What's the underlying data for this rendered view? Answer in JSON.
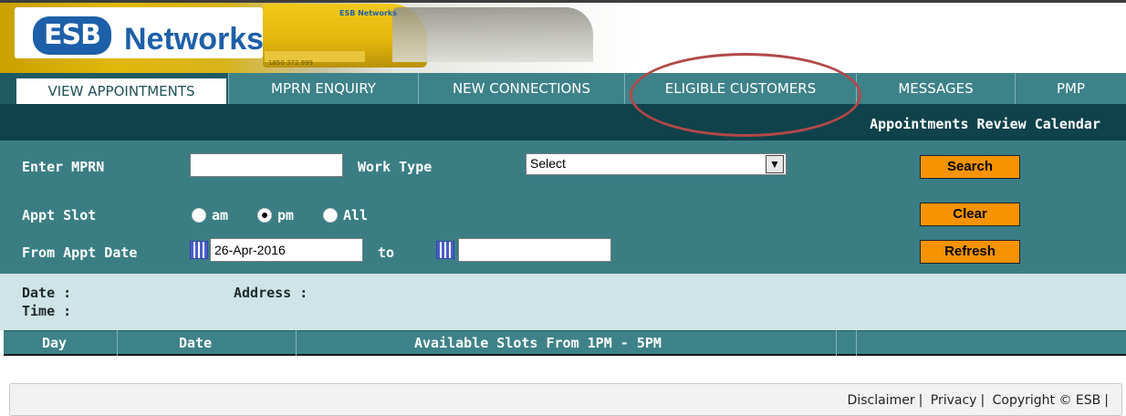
{
  "header": {
    "logo_text": "Networks",
    "logo_mark": "ESB",
    "banner_mini_logo": "ESB Networks",
    "banner_strip_text": "1850 372 999"
  },
  "tabs": [
    {
      "label": "VIEW APPOINTMENTS",
      "active": true
    },
    {
      "label": "MPRN ENQUIRY",
      "active": false
    },
    {
      "label": "NEW CONNECTIONS",
      "active": false
    },
    {
      "label": "ELIGIBLE CUSTOMERS",
      "active": false
    },
    {
      "label": "MESSAGES",
      "active": false
    },
    {
      "label": "PMP",
      "active": false
    }
  ],
  "subnav": {
    "link": "Appointments Review Calendar"
  },
  "form": {
    "mprn_label": "Enter MPRN",
    "mprn_value": "",
    "work_type_label": "Work Type",
    "work_type_selected": "Select",
    "search_button": "Search",
    "appt_slot_label": "Appt Slot",
    "slot_options": [
      {
        "label": "am",
        "selected": false
      },
      {
        "label": "pm",
        "selected": true
      },
      {
        "label": "All",
        "selected": false
      }
    ],
    "clear_button": "Clear",
    "from_date_label": "From Appt Date",
    "from_date_value": "26-Apr-2016",
    "to_label": "to",
    "to_date_value": "",
    "refresh_button": "Refresh"
  },
  "results": {
    "date_label": "Date :",
    "time_label": "Time :",
    "address_label": "Address :"
  },
  "grid": {
    "columns": [
      "Day",
      "Date",
      "Available Slots From 1PM - 5PM"
    ]
  },
  "footer": {
    "disclaimer": "Disclaimer",
    "privacy": "Privacy",
    "copyright": "Copyright © ESB"
  },
  "colors": {
    "tab_bg": "#3e8289",
    "dark_teal": "#0f424b",
    "panel": "#3a7e84",
    "button": "#f79300",
    "highlight_oval": "#b34848"
  }
}
